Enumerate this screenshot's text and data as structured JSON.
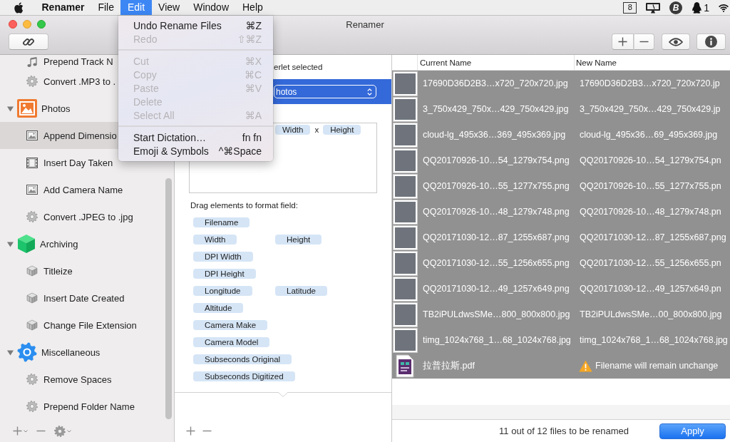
{
  "menu_bar": {
    "app_name": "Renamer",
    "menus": [
      {
        "label": "File",
        "selected": false
      },
      {
        "label": "Edit",
        "selected": true
      },
      {
        "label": "View",
        "selected": false
      },
      {
        "label": "Window",
        "selected": false
      },
      {
        "label": "Help",
        "selected": false
      }
    ],
    "status_items": [
      {
        "kind": "desktop",
        "text": "8"
      },
      {
        "kind": "display"
      },
      {
        "kind": "letter",
        "text": "B"
      },
      {
        "kind": "penguin",
        "text": "1"
      },
      {
        "kind": "wifi"
      }
    ]
  },
  "edit_menu": {
    "items": [
      {
        "kind": "item",
        "label": "Undo Rename Files",
        "shortcut": "⌘Z",
        "disabled": false
      },
      {
        "kind": "item",
        "label": "Redo",
        "shortcut": "⇧⌘Z",
        "disabled": true
      },
      {
        "kind": "separator"
      },
      {
        "kind": "item",
        "label": "Cut",
        "shortcut": "⌘X",
        "disabled": true
      },
      {
        "kind": "item",
        "label": "Copy",
        "shortcut": "⌘C",
        "disabled": true
      },
      {
        "kind": "item",
        "label": "Paste",
        "shortcut": "⌘V",
        "disabled": true
      },
      {
        "kind": "item",
        "label": "Delete",
        "disabled": true
      },
      {
        "kind": "item",
        "label": "Select All",
        "shortcut": "⌘A",
        "disabled": true
      },
      {
        "kind": "separator"
      },
      {
        "kind": "item",
        "label": "Start Dictation…",
        "shortcut": "fn fn",
        "disabled": false
      },
      {
        "kind": "item",
        "label": "Emoji & Symbols",
        "shortcut": "^⌘Space",
        "disabled": false
      }
    ]
  },
  "window": {
    "title": "Renamer"
  },
  "sidebar": {
    "leading_items": [
      {
        "label": "Prepend Track N",
        "kind": "note",
        "selected": false
      },
      {
        "label": "Convert .MP3 to .",
        "kind": "gear",
        "selected": false
      }
    ],
    "groups": [
      {
        "label": "Photos",
        "kind": "photos",
        "expanded": true,
        "items": [
          {
            "label": "Append Dimensio",
            "kind": "image",
            "selected": true
          },
          {
            "label": "Insert Day Taken",
            "kind": "film",
            "selected": false
          },
          {
            "label": "Add Camera Name",
            "kind": "image",
            "selected": false
          },
          {
            "label": "Convert .JPEG to .jpg",
            "kind": "gear",
            "selected": false
          }
        ]
      },
      {
        "label": "Archiving",
        "kind": "archive",
        "expanded": true,
        "items": [
          {
            "label": "Titleize",
            "kind": "cube",
            "selected": false
          },
          {
            "label": "Insert Date Created",
            "kind": "cube",
            "selected": false
          },
          {
            "label": "Change File Extension",
            "kind": "cube",
            "selected": false
          }
        ]
      },
      {
        "label": "Miscellaneous",
        "kind": "settings",
        "expanded": true,
        "items": [
          {
            "label": "Remove Spaces",
            "kind": "gear",
            "selected": false
          },
          {
            "label": "Prepend Folder Name",
            "kind": "gear",
            "selected": false
          }
        ]
      }
    ]
  },
  "editor": {
    "status": "erlet selected",
    "preset": "hotos",
    "format_tokens": [
      {
        "kind": "token",
        "label": "Width"
      },
      {
        "kind": "text",
        "label": "x"
      },
      {
        "kind": "token",
        "label": "Height"
      }
    ],
    "palette_label": "Drag elements to format field:",
    "palette_rows": [
      {
        "tokens": [
          "Filename"
        ]
      },
      {
        "tokens": [
          "Width",
          "Height"
        ]
      },
      {
        "tokens": [
          "DPI Width"
        ]
      },
      {
        "tokens": [
          "DPI Height"
        ]
      },
      {
        "tokens": [
          "Longitude",
          "Latitude"
        ]
      },
      {
        "tokens": [
          "Altitude"
        ]
      },
      {
        "tokens": [
          "Camera Make"
        ]
      },
      {
        "tokens": [
          "Camera Model"
        ]
      },
      {
        "tokens": [
          "Subseconds Original"
        ]
      },
      {
        "tokens": [
          "Subseconds Digitized"
        ]
      }
    ]
  },
  "table": {
    "columns": [
      "Current Name",
      "New Name"
    ],
    "rows": [
      {
        "kind": "image",
        "current_name": "17690D36D2B3…x720_720x720.jpg",
        "new_name": "17690D36D2B3…x720_720x720.jp",
        "selected": true
      },
      {
        "kind": "image",
        "current_name": "3_750x429_750x…429_750x429.jpg",
        "new_name": "3_750x429_750x…429_750x429.jp",
        "selected": true
      },
      {
        "kind": "image",
        "current_name": "cloud-lg_495x36…369_495x369.jpg",
        "new_name": "cloud-lg_495x36…69_495x369.jpg",
        "selected": true
      },
      {
        "kind": "image",
        "current_name": "QQ20170926-10…54_1279x754.png",
        "new_name": "QQ20170926-10…54_1279x754.pn",
        "selected": true
      },
      {
        "kind": "image",
        "current_name": "QQ20170926-10…55_1277x755.png",
        "new_name": "QQ20170926-10…55_1277x755.pn",
        "selected": true
      },
      {
        "kind": "image",
        "current_name": "QQ20170926-10…48_1279x748.png",
        "new_name": "QQ20170926-10…48_1279x748.pn",
        "selected": true
      },
      {
        "kind": "image",
        "current_name": "QQ20171030-12…87_1255x687.png",
        "new_name": "QQ20171030-12…87_1255x687.png",
        "selected": true
      },
      {
        "kind": "image",
        "current_name": "QQ20171030-12…55_1256x655.png",
        "new_name": "QQ20171030-12…55_1256x655.pn",
        "selected": true
      },
      {
        "kind": "image",
        "current_name": "QQ20171030-12…49_1257x649.png",
        "new_name": "QQ20171030-12…49_1257x649.pn",
        "selected": true
      },
      {
        "kind": "image",
        "current_name": "TB2iPULdwsSMe…800_800x800.jpg",
        "new_name": "TB2iPULdwsSMe…00_800x800.jpg",
        "selected": true
      },
      {
        "kind": "image",
        "current_name": "timg_1024x768_1…68_1024x768.jpg",
        "new_name": "timg_1024x768_1…68_1024x768.jpg",
        "selected": true
      },
      {
        "kind": "document",
        "current_name": "拉普拉斯.pdf",
        "warning": "Filename will remain unchange",
        "selected": true
      }
    ]
  },
  "footer": {
    "status": "11 out of 12 files to be renamed",
    "button": "Apply"
  }
}
